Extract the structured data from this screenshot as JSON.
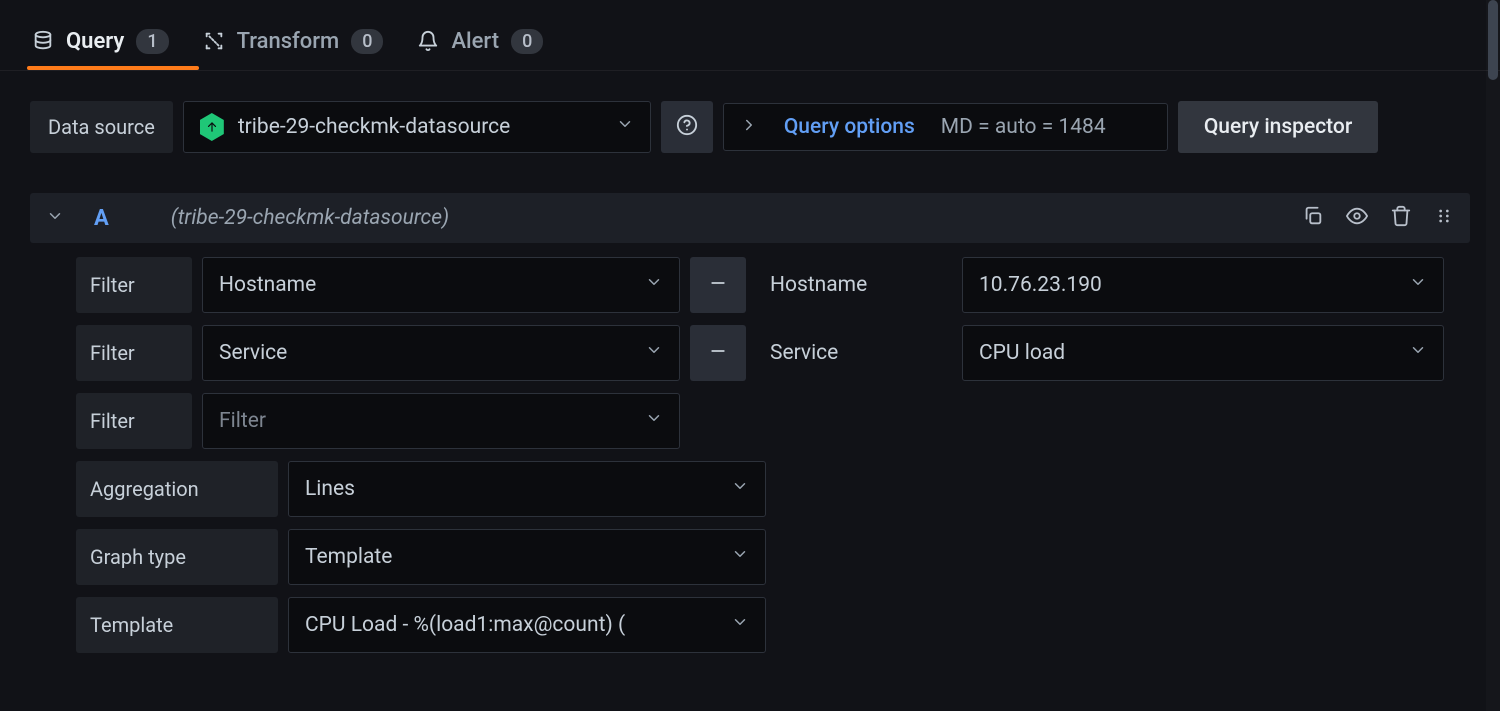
{
  "tabs": {
    "query": {
      "label": "Query",
      "count": "1"
    },
    "transform": {
      "label": "Transform",
      "count": "0"
    },
    "alert": {
      "label": "Alert",
      "count": "0"
    }
  },
  "toolbar": {
    "datasource_label": "Data source",
    "datasource_value": "tribe-29-checkmk-datasource",
    "query_options_label": "Query options",
    "query_options_meta": "MD = auto = 1484",
    "query_inspector_label": "Query inspector"
  },
  "query": {
    "letter": "A",
    "datasource": "(tribe-29-checkmk-datasource)",
    "rows": {
      "filter1": {
        "label": "Filter",
        "type": "Hostname",
        "value_label": "Hostname",
        "value": "10.76.23.190"
      },
      "filter2": {
        "label": "Filter",
        "type": "Service",
        "value_label": "Service",
        "value": "CPU load"
      },
      "filter3": {
        "label": "Filter",
        "placeholder": "Filter"
      },
      "aggregation": {
        "label": "Aggregation",
        "value": "Lines"
      },
      "graphtype": {
        "label": "Graph type",
        "value": "Template"
      },
      "template": {
        "label": "Template",
        "value": "CPU Load - %(load1:max@count) ("
      }
    }
  }
}
